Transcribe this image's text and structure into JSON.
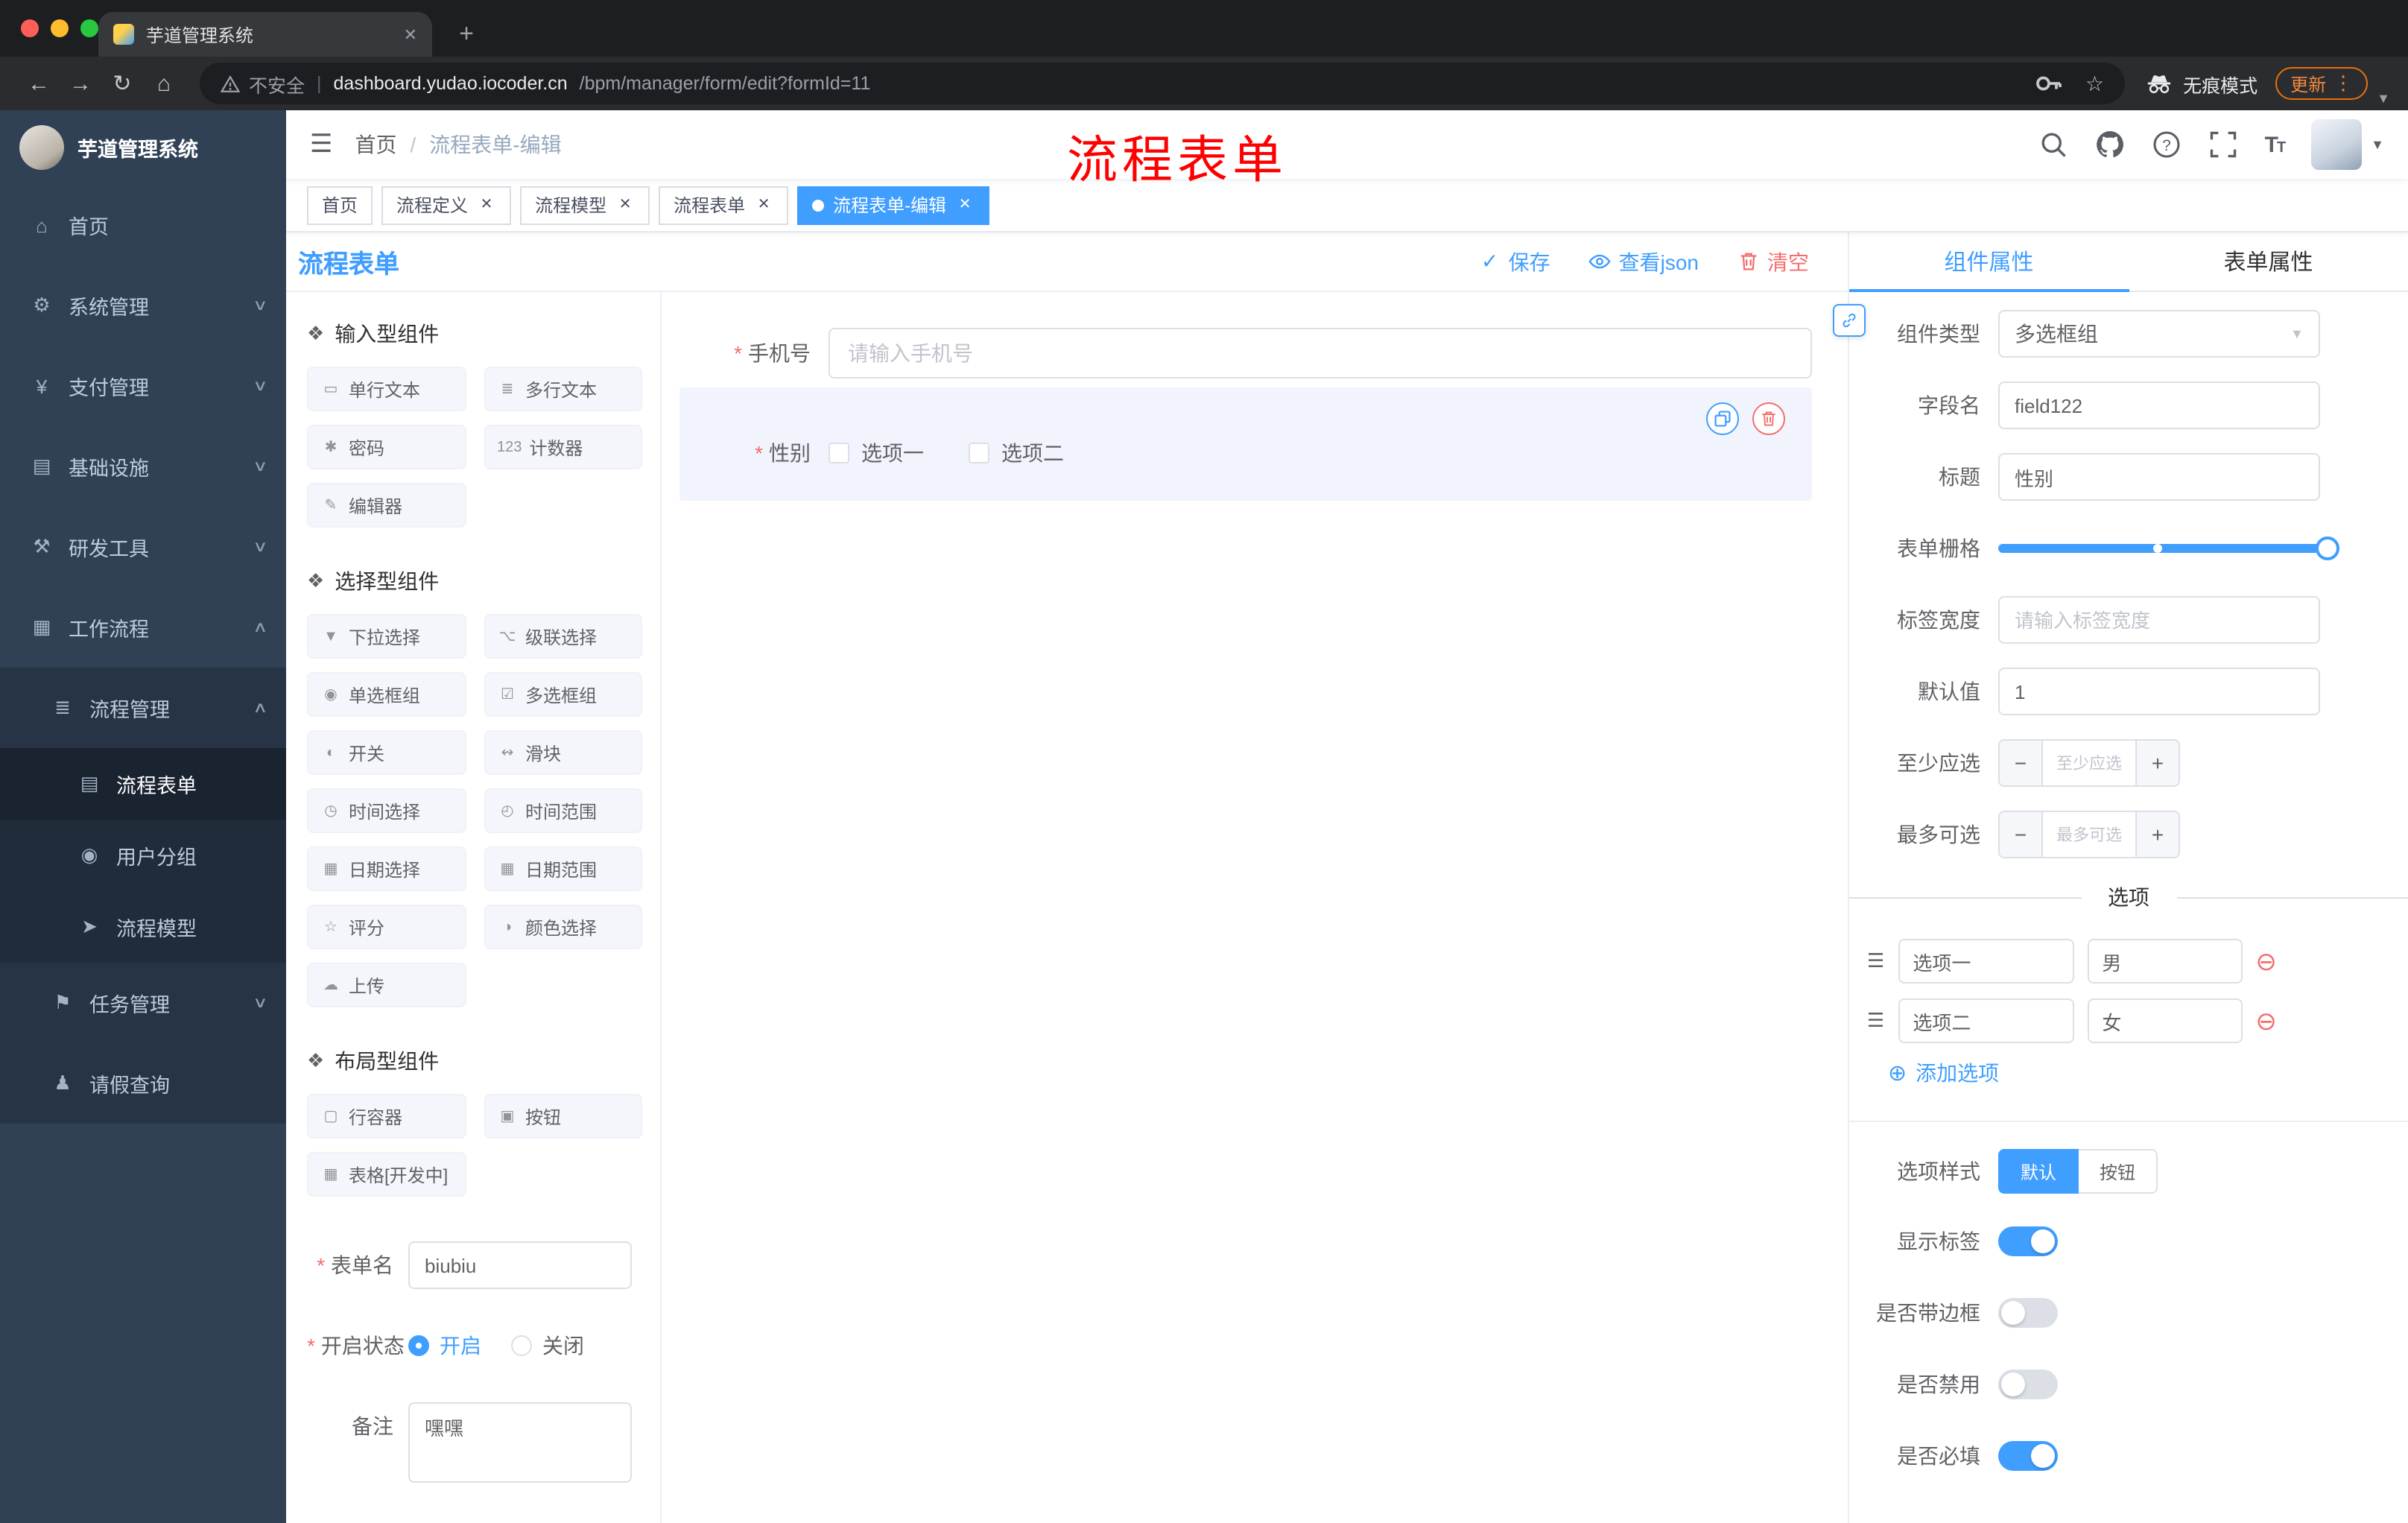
{
  "browser": {
    "tab_title": "芋道管理系统",
    "security_label": "不安全",
    "url_domain": "dashboard.yudao.iocoder.cn",
    "url_path": "/bpm/manager/form/edit?formId=11",
    "incognito_label": "无痕模式",
    "update_label": "更新"
  },
  "sidebar": {
    "logo_title": "芋道管理系统",
    "items": [
      {
        "label": "首页",
        "glyph": "⌂"
      },
      {
        "label": "系统管理",
        "glyph": "⚙",
        "chevron": "∨"
      },
      {
        "label": "支付管理",
        "glyph": "¥",
        "chevron": "∨"
      },
      {
        "label": "基础设施",
        "glyph": "▤",
        "chevron": "∨"
      },
      {
        "label": "研发工具",
        "glyph": "⚒",
        "chevron": "∨"
      },
      {
        "label": "工作流程",
        "glyph": "▦",
        "chevron": "∧"
      },
      {
        "label": "流程管理",
        "glyph": "≣",
        "chevron": "∧"
      },
      {
        "label": "流程表单",
        "glyph": "▤"
      },
      {
        "label": "用户分组",
        "glyph": "◉"
      },
      {
        "label": "流程模型",
        "glyph": "➤"
      },
      {
        "label": "任务管理",
        "glyph": "⚑",
        "chevron": "∨"
      },
      {
        "label": "请假查询",
        "glyph": "♟"
      }
    ]
  },
  "header": {
    "breadcrumb": {
      "root": "首页",
      "current": "流程表单-编辑"
    },
    "annotation": "流程表单"
  },
  "tags": [
    {
      "label": "首页"
    },
    {
      "label": "流程定义",
      "close": "✕"
    },
    {
      "label": "流程模型",
      "close": "✕"
    },
    {
      "label": "流程表单",
      "close": "✕"
    },
    {
      "label": "流程表单-编辑",
      "close": "✕",
      "active": true
    }
  ],
  "designer": {
    "title": "流程表单",
    "toolbar": {
      "save": "保存",
      "view_json": "查看json",
      "clear": "清空",
      "save_glyph": "✓"
    },
    "group_icon": "❖",
    "groups": [
      {
        "title": "输入型组件",
        "items": [
          {
            "label": "单行文本",
            "glyph": "▭"
          },
          {
            "label": "多行文本",
            "glyph": "≣"
          },
          {
            "label": "密码",
            "glyph": "✱"
          },
          {
            "label": "计数器",
            "glyph": "123"
          },
          {
            "label": "编辑器",
            "glyph": "✎"
          }
        ]
      },
      {
        "title": "选择型组件",
        "items": [
          {
            "label": "下拉选择",
            "glyph": "▼"
          },
          {
            "label": "级联选择",
            "glyph": "⌥"
          },
          {
            "label": "单选框组",
            "glyph": "◉"
          },
          {
            "label": "多选框组",
            "glyph": "☑"
          },
          {
            "label": "开关",
            "glyph": "◐"
          },
          {
            "label": "滑块",
            "glyph": "↭"
          },
          {
            "label": "时间选择",
            "glyph": "◷"
          },
          {
            "label": "时间范围",
            "glyph": "◴"
          },
          {
            "label": "日期选择",
            "glyph": "▦"
          },
          {
            "label": "日期范围",
            "glyph": "▦"
          },
          {
            "label": "评分",
            "glyph": "☆"
          },
          {
            "label": "颜色选择",
            "glyph": "◑"
          },
          {
            "label": "上传",
            "glyph": "☁"
          }
        ]
      },
      {
        "title": "布局型组件",
        "items": [
          {
            "label": "行容器",
            "glyph": "▢"
          },
          {
            "label": "按钮",
            "glyph": "▣"
          },
          {
            "label": "表格[开发中]",
            "glyph": "▦"
          }
        ]
      }
    ],
    "form_meta": {
      "name_label": "表单名",
      "name_value": "biubiu",
      "status_label": "开启状态",
      "status_on": "开启",
      "status_off": "关闭",
      "remark_label": "备注",
      "remark_value": "嘿嘿"
    }
  },
  "canvas": {
    "phone_label": "手机号",
    "phone_placeholder": "请输入手机号",
    "gender_label": "性别",
    "gender_options": [
      "选项一",
      "选项二"
    ]
  },
  "props": {
    "tabs": [
      "组件属性",
      "表单属性"
    ],
    "component_type_label": "组件类型",
    "component_type_value": "多选框组",
    "field_name_label": "字段名",
    "field_name_value": "field122",
    "title_label": "标题",
    "title_value": "性别",
    "grid_label": "表单栅格",
    "label_width_label": "标签宽度",
    "label_width_placeholder": "请输入标签宽度",
    "default_label": "默认值",
    "default_value": "1",
    "min_label": "至少应选",
    "min_placeholder": "至少应选",
    "max_label": "最多可选",
    "max_placeholder": "最多可选",
    "options_title": "选项",
    "options": [
      {
        "label": "选项一",
        "value": "男"
      },
      {
        "label": "选项二",
        "value": "女"
      }
    ],
    "add_option": "添加选项",
    "option_style_label": "选项样式",
    "style_default": "默认",
    "style_button": "按钮",
    "switches": [
      {
        "label": "显示标签",
        "on": true
      },
      {
        "label": "是否带边框",
        "on": false
      },
      {
        "label": "是否禁用",
        "on": false
      },
      {
        "label": "是否必填",
        "on": true
      }
    ]
  },
  "colors": {
    "accent": "#409eff",
    "danger": "#f56c6c",
    "annotation": "#fe0000"
  }
}
